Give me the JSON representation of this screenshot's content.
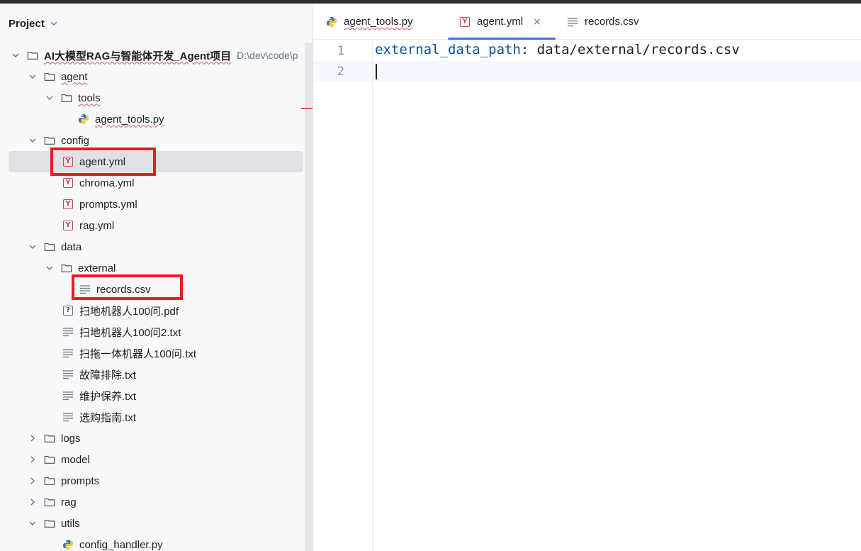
{
  "sidebar": {
    "title": "Project",
    "project_name": "AI大模型RAG与智能体开发_Agent项目",
    "project_path": "D:\\dev\\code\\p",
    "tree": {
      "agent": "agent",
      "tools": "tools",
      "agent_tools": "agent_tools.py",
      "config": "config",
      "agent_yml": "agent.yml",
      "chroma_yml": "chroma.yml",
      "prompts_yml": "prompts.yml",
      "rag_yml": "rag.yml",
      "data": "data",
      "external": "external",
      "records_csv": "records.csv",
      "pdf_file": "扫地机器人100问.pdf",
      "txt1": "扫地机器人100问2.txt",
      "txt2": "扫拖一体机器人100问.txt",
      "txt3": "故障排除.txt",
      "txt4": "维护保养.txt",
      "txt5": "选购指南.txt",
      "logs": "logs",
      "model": "model",
      "prompts": "prompts",
      "rag": "rag",
      "utils": "utils",
      "config_handler": "config_handler.py"
    }
  },
  "editor": {
    "tabs": [
      {
        "label": "agent_tools.py",
        "icon": "python-icon"
      },
      {
        "label": "agent.yml",
        "icon": "yaml-icon",
        "active": true
      },
      {
        "label": "records.csv",
        "icon": "text-file-icon"
      }
    ],
    "close_glyph": "×",
    "line_numbers": [
      "1",
      "2"
    ],
    "code": {
      "key": "external_data_path",
      "colon": ":",
      "value": " data/external/records.csv"
    }
  },
  "glyphs": {
    "yml": "Y",
    "pdf": "?"
  },
  "colors": {
    "accent": "#3574f0",
    "highlight": "#ea1b23",
    "yaml_key": "#0b4f9e",
    "yml_icon": "#c6474f"
  }
}
